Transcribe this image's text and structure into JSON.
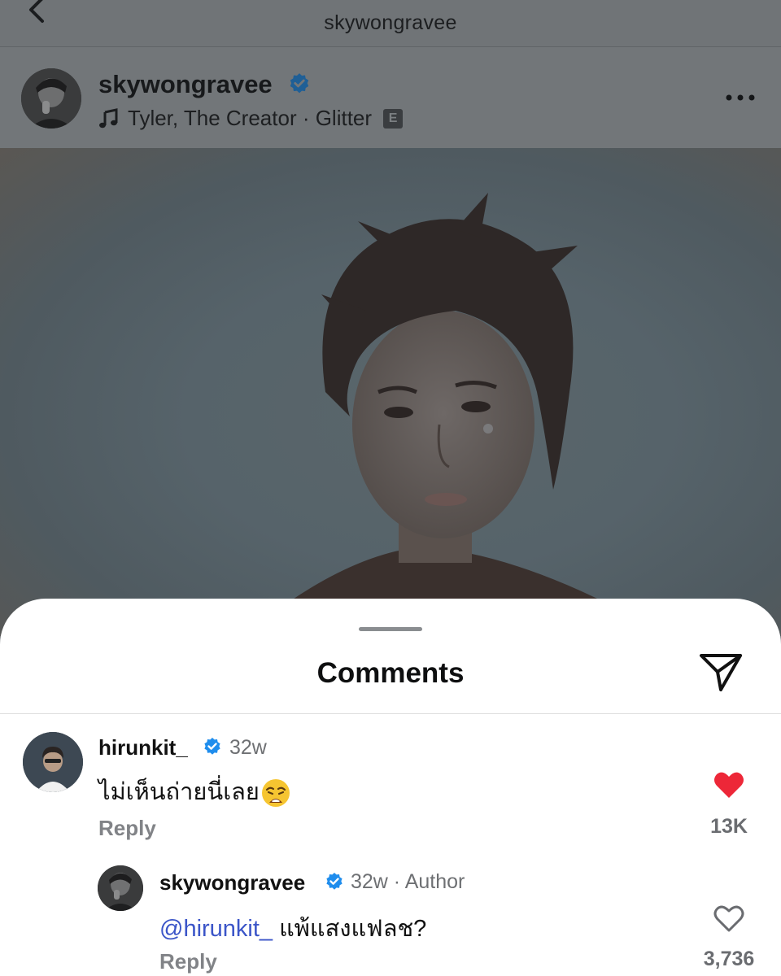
{
  "topbar": {
    "title": "skywongravee"
  },
  "post": {
    "username": "skywongravee",
    "music_artist_track": "Tyler, The Creator · Glitter",
    "explicit_label": "E"
  },
  "sheet": {
    "title": "Comments"
  },
  "comments": [
    {
      "username": "hirunkit_",
      "age": "32w",
      "text": "ไม่เห็นถ่ายนี่เลย",
      "reply_label": "Reply",
      "like_count": "13K",
      "liked": true
    },
    {
      "username": "skywongravee",
      "age_author": "32w · Author",
      "mention": "@hirunkit_",
      "text": " แพ้แสงแฟลช?",
      "reply_label": "Reply",
      "like_count": "3,736",
      "liked": false
    }
  ],
  "colors": {
    "verified": "#1f8ded",
    "like_red": "#ed2738",
    "mention_blue": "#3b55c8"
  },
  "icons": [
    "back-icon",
    "verified-icon",
    "music-note-icon",
    "more-icon",
    "share-icon",
    "heart-icon",
    "weary-emoji-icon"
  ]
}
